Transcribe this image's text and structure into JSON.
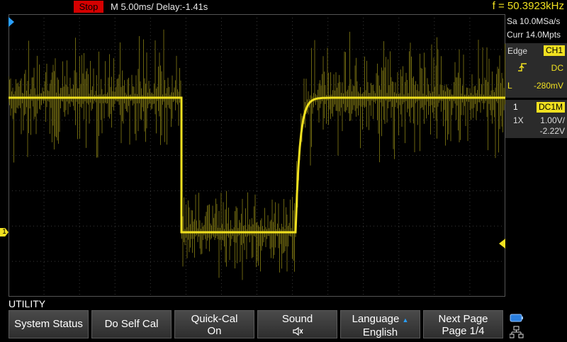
{
  "status": {
    "run_state": "Stop",
    "timebase": "M 5.00ms/ Delay:-1.41s",
    "frequency": "f = 50.3923kHz"
  },
  "acquisition": {
    "sample_rate": "Sa 10.0MSa/s",
    "memory_depth": "Curr 14.0Mpts"
  },
  "trigger": {
    "type": "Edge",
    "source": "CH1",
    "slope_icon": "rising-edge-icon",
    "coupling": "DC",
    "level_label": "L",
    "level_value": "-280mV"
  },
  "channel1": {
    "number": "1",
    "coupling": "DC1M",
    "probe": "1X",
    "scale": "1.00V/",
    "offset": "-2.22V",
    "marker": "1",
    "color": "#f0e020"
  },
  "menu": {
    "title": "UTILITY",
    "softkeys": [
      {
        "line1": "System Status"
      },
      {
        "line1": "Do Self Cal"
      },
      {
        "line1": "Quick-Cal",
        "line2": "On"
      },
      {
        "line1": "Sound",
        "line2_icon": "speaker-muted-icon"
      },
      {
        "line1": "Language",
        "line2": "English",
        "line1_icon": "up-arrow-icon"
      },
      {
        "line1": "Next Page",
        "line2": "Page 1/4"
      }
    ]
  },
  "tray_icons": [
    "usb-storage-icon",
    "network-icon"
  ],
  "colors": {
    "trace": "#f0e020",
    "stop": "#d40000",
    "trigger_marker": "#2aa0ff"
  }
}
